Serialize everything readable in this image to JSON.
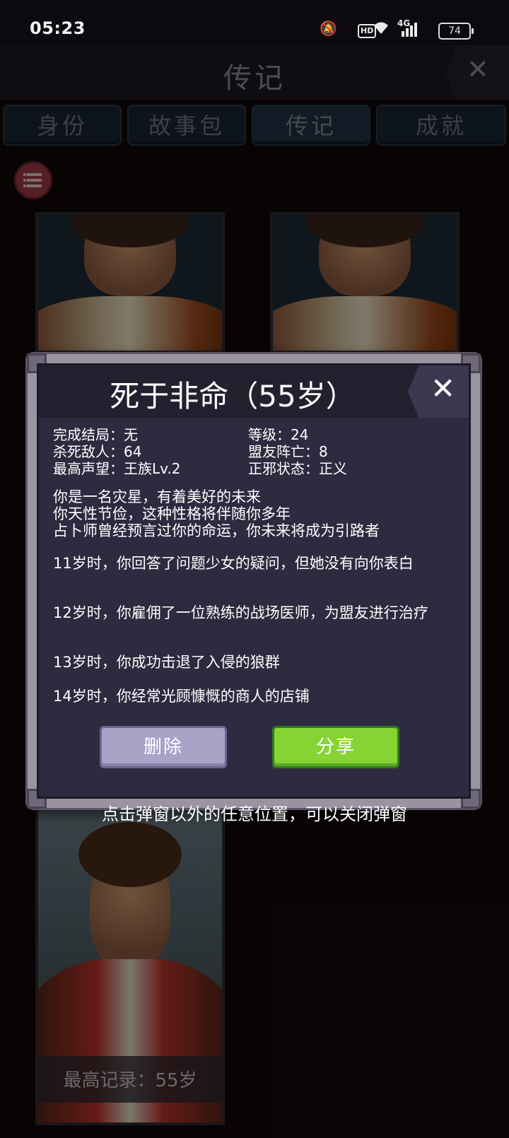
{
  "status_bar": {
    "time": "05:23",
    "hd": "HD",
    "network": "4G",
    "battery": "74"
  },
  "header": {
    "title": "传记",
    "close_icon": "✕"
  },
  "tabs": [
    {
      "label": "身份"
    },
    {
      "label": "故事包"
    },
    {
      "label": "传记"
    },
    {
      "label": "成就"
    }
  ],
  "list_button_icon": "list-icon",
  "bottom_card": {
    "record_label": "最高记录：55岁"
  },
  "modal": {
    "title": "死于非命（55岁）",
    "close_icon": "✕",
    "stats": {
      "ending": "完成结局：无",
      "level": "等级：24",
      "kills": "杀死敌人：64",
      "ally_deaths": "盟友阵亡：8",
      "reputation": "最高声望：王族Lv.2",
      "alignment": "正邪状态：正义"
    },
    "intro": [
      "你是一名灾星，有着美好的未来",
      "你天性节俭，这种性格将伴随你多年",
      "占卜师曾经预言过你的命运，你未来将成为引路者"
    ],
    "events": [
      "11岁时，你回答了问题少女的疑问，但她没有向你表白",
      "12岁时，你雇佣了一位熟练的战场医师，为盟友进行治疗",
      "13岁时，你成功击退了入侵的狼群",
      "14岁时，你经常光顾慷慨的商人的店铺"
    ],
    "delete_label": "删除",
    "share_label": "分享"
  },
  "hint": "点击弹窗以外的任意位置，可以关闭弹窗",
  "colors": {
    "share_green": "#86d433",
    "delete_lavender": "#a9a3c8",
    "modal_bg": "#2e2b40"
  }
}
